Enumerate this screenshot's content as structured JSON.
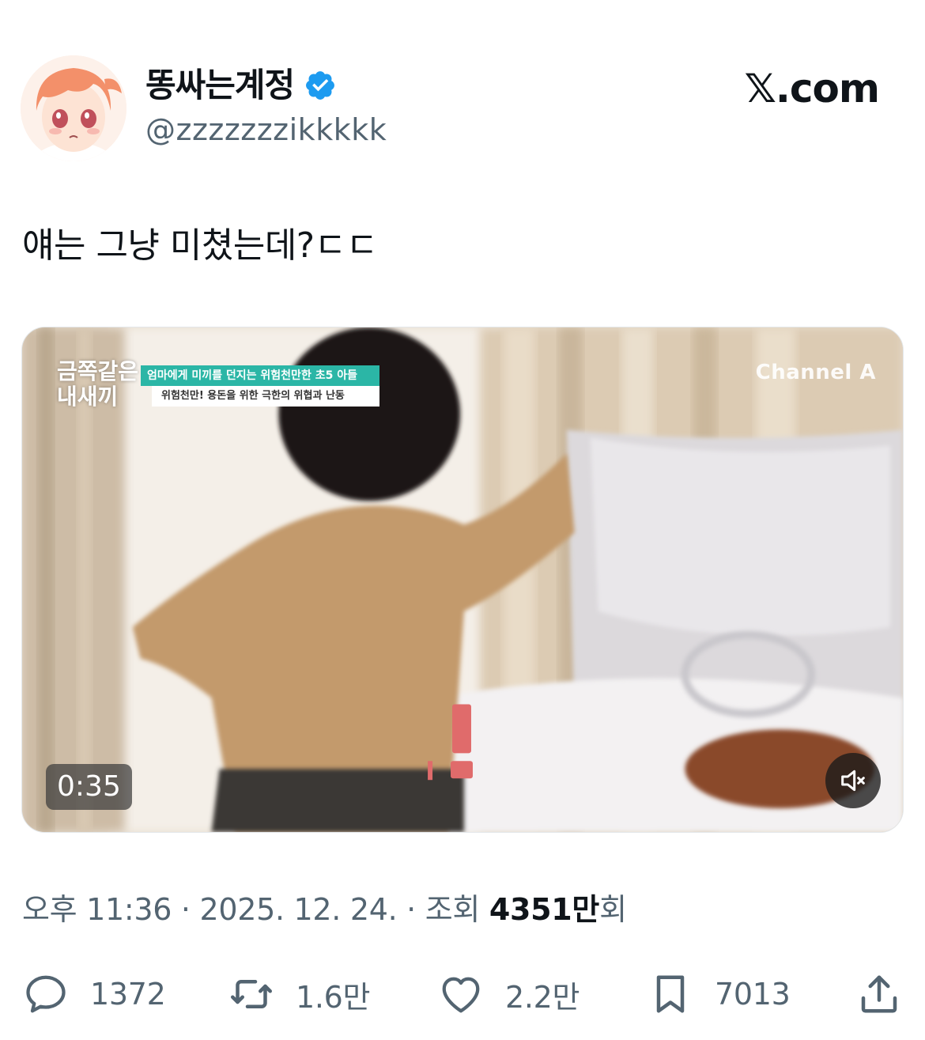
{
  "author": {
    "display_name": "똥싸는계정",
    "handle": "@zzzzzzzikkkkk",
    "verified_icon": "verified-badge-icon",
    "avatar_icon": "anime-avatar"
  },
  "site_logo": "𝕏.com",
  "tweet_text": "얘는 그냥 미쳤는데?ㄷㄷ",
  "media": {
    "show_logo": "금쪽같은 내새끼",
    "caption_top": "엄마에게 미끼를 던지는 위험천만한 초5 아들",
    "caption_bottom": "위험천만! 용돈을 위한 극한의 위협과 난동",
    "channel_logo": "Channel A",
    "duration": "0:35",
    "mute_icon": "speaker-muted-icon"
  },
  "meta": {
    "time": "오후 11:36",
    "separator": "·",
    "date": "2025. 12. 24.",
    "views_label": "조회",
    "views_count": "4351",
    "views_unit": "만",
    "views_suffix": "회"
  },
  "actions": {
    "replies": "1372",
    "retweets": "1.6만",
    "likes": "2.2만",
    "bookmarks": "7013"
  },
  "colors": {
    "text_primary": "#0f1419",
    "text_secondary": "#536471",
    "verified_blue": "#1d9bf0",
    "caption_teal": "#2bb6a6"
  }
}
